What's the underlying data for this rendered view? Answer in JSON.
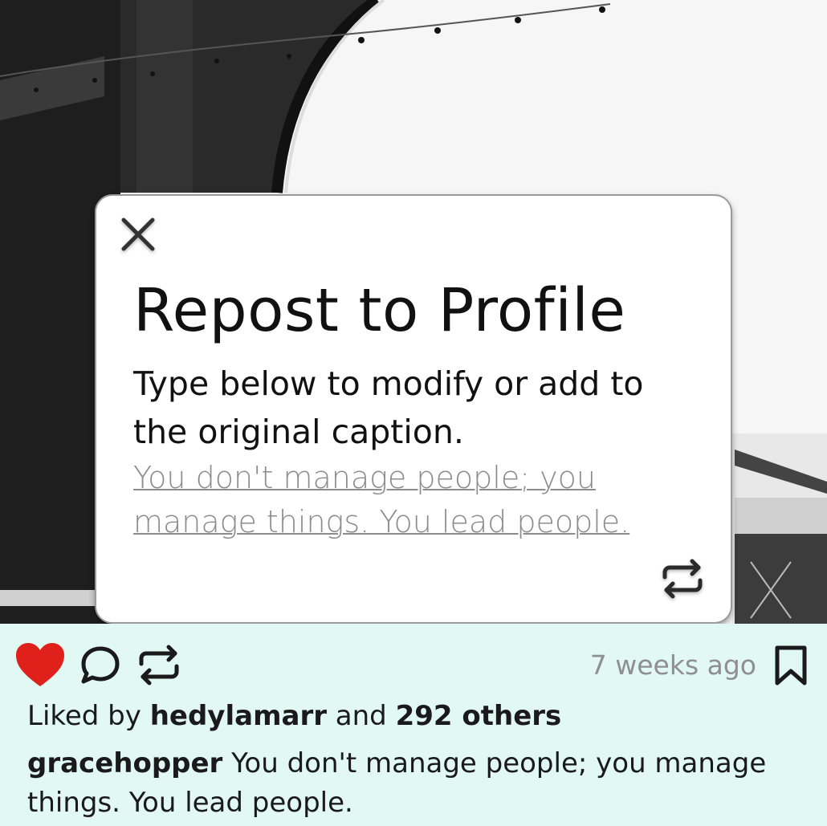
{
  "modal": {
    "title": "Repost to Profile",
    "description": "Type below to modify or add to the original caption.",
    "caption_value": "You don't manage people; you manage things. You lead people."
  },
  "post": {
    "timestamp": "7 weeks ago",
    "likes_prefix": "Liked by",
    "liked_by_user": "hedylamarr",
    "likes_middle": "and",
    "others": "292 others",
    "author": "gracehopper",
    "caption": "You don't manage people; you manage things. You lead people."
  },
  "colors": {
    "footer_bg": "#e1f8f3",
    "heart": "#e0201b"
  },
  "icons": [
    "close-icon",
    "repost-icon",
    "heart-icon",
    "comment-icon",
    "bookmark-icon"
  ]
}
